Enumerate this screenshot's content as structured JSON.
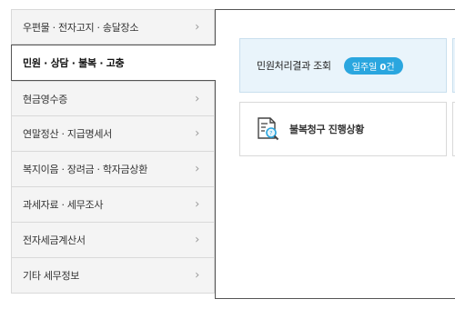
{
  "sidebar": {
    "items": [
      {
        "label": "우편물 · 전자고지 · 송달장소",
        "chevron": "›"
      },
      {
        "label": "민원 · 상담 · 불복 · 고충",
        "chevron": ""
      },
      {
        "label": "현금영수증",
        "chevron": "›"
      },
      {
        "label": "연말정산 · 지급명세서",
        "chevron": "›"
      },
      {
        "label": "복지이음 · 장려금 · 학자금상환",
        "chevron": "›"
      },
      {
        "label": "과세자료 · 세무조사",
        "chevron": "›"
      },
      {
        "label": "전자세금계산서",
        "chevron": "›"
      },
      {
        "label": "기타 세무정보",
        "chevron": "›"
      }
    ]
  },
  "main": {
    "cards": [
      {
        "title": "민원처리결과 조회",
        "badge_prefix": "일주일",
        "badge_count": "0",
        "badge_suffix": "건"
      },
      {
        "title": "불복청구 진행상황",
        "icon": "document-search-icon"
      }
    ]
  },
  "colors": {
    "badge": "#2aa6df",
    "active_border": "#555555",
    "card_highlight": "#e9f4fb"
  }
}
